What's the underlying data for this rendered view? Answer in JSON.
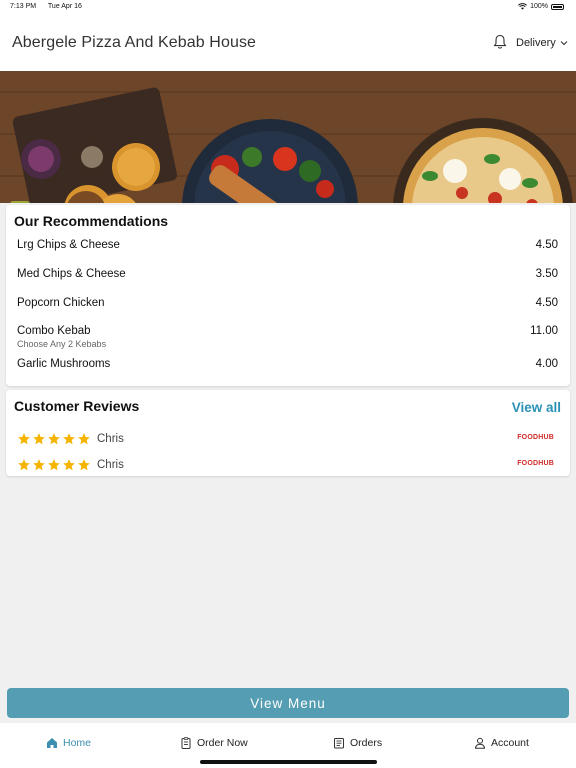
{
  "status_bar": {
    "time": "7:13 PM",
    "date": "Tue Apr 16",
    "battery": "100%",
    "wifi_icon": "wifi-icon",
    "battery_icon": "battery-icon"
  },
  "header": {
    "title": "Abergele Pizza And Kebab House",
    "bell_icon": "bell-icon",
    "order_mode": "Delivery",
    "chevron_icon": "chevron-down-icon"
  },
  "hero": {
    "image": "food-banner"
  },
  "recommendations": {
    "heading": "Our Recommendations",
    "items": [
      {
        "name": "Lrg Chips & Cheese",
        "price": "4.50",
        "subtitle": ""
      },
      {
        "name": "Med Chips & Cheese",
        "price": "3.50",
        "subtitle": ""
      },
      {
        "name": "Popcorn Chicken",
        "price": "4.50",
        "subtitle": ""
      },
      {
        "name": "Combo Kebab",
        "price": "11.00",
        "subtitle": "Choose Any 2 Kebabs"
      },
      {
        "name": "Garlic Mushrooms",
        "price": "4.00",
        "subtitle": ""
      }
    ]
  },
  "reviews": {
    "heading": "Customer Reviews",
    "view_all": "View all",
    "items": [
      {
        "rating": 5,
        "author": "Chris",
        "source": "FOODHUB"
      },
      {
        "rating": 5,
        "author": "Chris",
        "source": "FOODHUB"
      }
    ],
    "star_color": "#f5b400"
  },
  "cta": {
    "label": "View Menu",
    "color": "#559db3"
  },
  "tabbar": {
    "items": [
      {
        "label": "Home",
        "icon": "home-icon",
        "active": true
      },
      {
        "label": "Order Now",
        "icon": "clipboard-icon",
        "active": false
      },
      {
        "label": "Orders",
        "icon": "receipt-icon",
        "active": false
      },
      {
        "label": "Account",
        "icon": "user-icon",
        "active": false
      }
    ],
    "active_color": "#3b8fb0"
  }
}
